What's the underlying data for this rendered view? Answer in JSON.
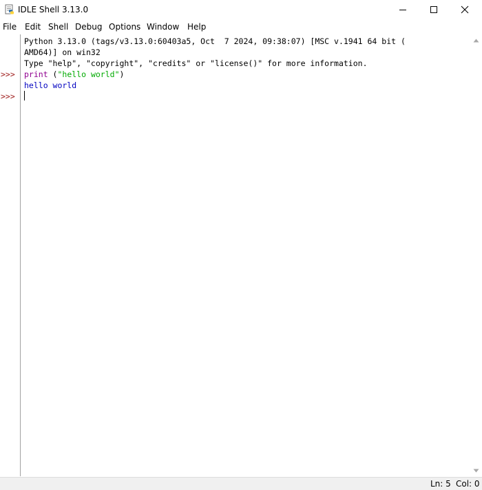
{
  "window": {
    "title": "IDLE Shell 3.13.0",
    "icon": "python-idle-icon"
  },
  "menu": {
    "items": [
      "File",
      "Edit",
      "Shell",
      "Debug",
      "Options",
      "Window",
      "Help"
    ]
  },
  "shell": {
    "prompt": ">>>",
    "banner_line1": "Python 3.13.0 (tags/v3.13.0:60403a5, Oct  7 2024, 09:38:07) [MSC v.1941 64 bit (",
    "banner_line2": "AMD64)] on win32",
    "banner_line3": "Type \"help\", \"copyright\", \"credits\" or \"license()\" for more information.",
    "input_builtin": "print",
    "input_open": " (",
    "input_string": "\"hello world\"",
    "input_close": ")",
    "output": "hello world"
  },
  "status": {
    "line": "Ln: 5",
    "column": "Col: 0"
  },
  "colors": {
    "prompt": "#A0201F",
    "builtin": "#900090",
    "string": "#00AA00",
    "output": "#0000C0"
  }
}
